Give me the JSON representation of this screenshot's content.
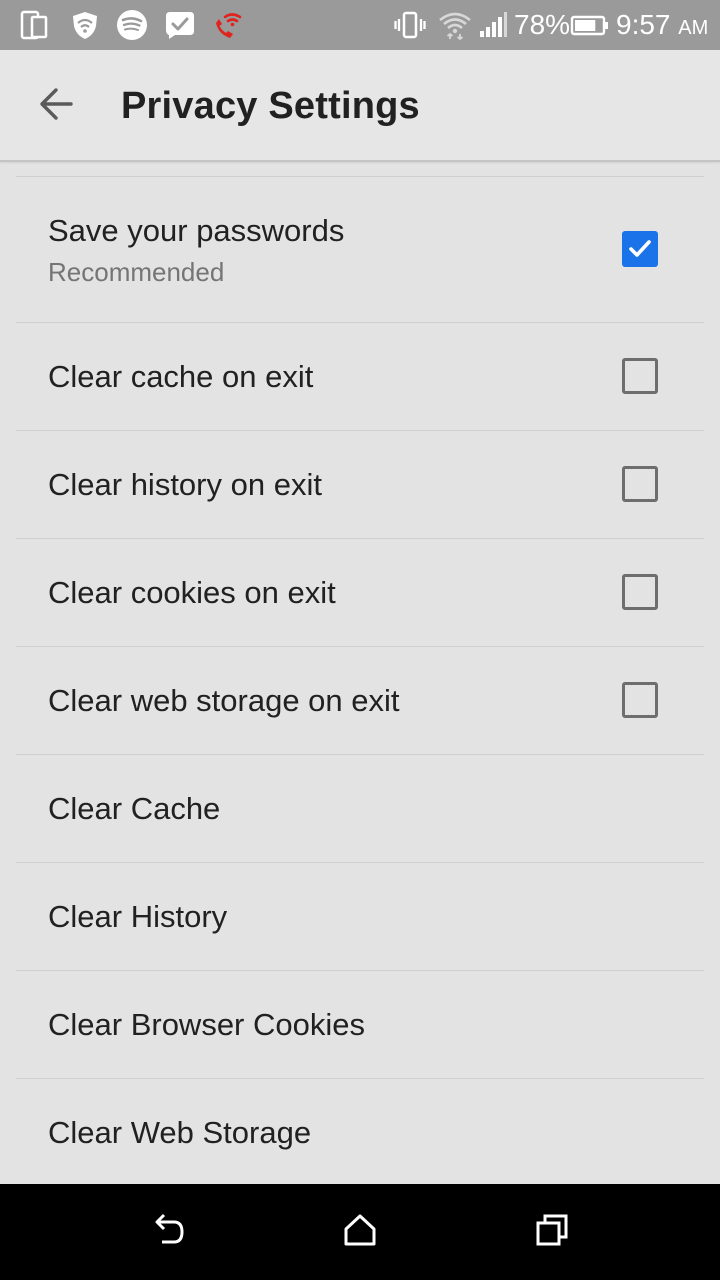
{
  "status_bar": {
    "battery_percent": "78%",
    "battery_level": 0.78,
    "time": "9:57",
    "ampm": "AM",
    "icons": [
      "dual-screen-icon",
      "shield-wifi-icon",
      "spotify-icon",
      "check-chat-icon",
      "wifi-call-icon",
      "vibrate-icon",
      "wifi-icon",
      "cell-signal-icon",
      "battery-icon"
    ]
  },
  "app_bar": {
    "title": "Privacy Settings",
    "back_icon": "arrow-back-icon"
  },
  "settings": {
    "save_passwords": {
      "title": "Save your passwords",
      "subtitle": "Recommended",
      "checked": true
    },
    "clear_cache_exit": {
      "title": "Clear cache on exit",
      "checked": false
    },
    "clear_history_exit": {
      "title": "Clear history on exit",
      "checked": false
    },
    "clear_cookies_exit": {
      "title": "Clear cookies on exit",
      "checked": false
    },
    "clear_storage_exit": {
      "title": "Clear web storage on exit",
      "checked": false
    },
    "clear_cache": {
      "title": "Clear Cache"
    },
    "clear_history": {
      "title": "Clear History"
    },
    "clear_cookies": {
      "title": "Clear Browser Cookies"
    },
    "clear_storage": {
      "title": "Clear Web Storage"
    }
  },
  "colors": {
    "accent": "#1a73e8",
    "status_bar": "#9a9a9a",
    "background": "#e3e3e3",
    "wifi_call": "#e0231e"
  },
  "nav_bar": {
    "icons": [
      "back-nav-icon",
      "home-nav-icon",
      "recents-nav-icon"
    ]
  }
}
